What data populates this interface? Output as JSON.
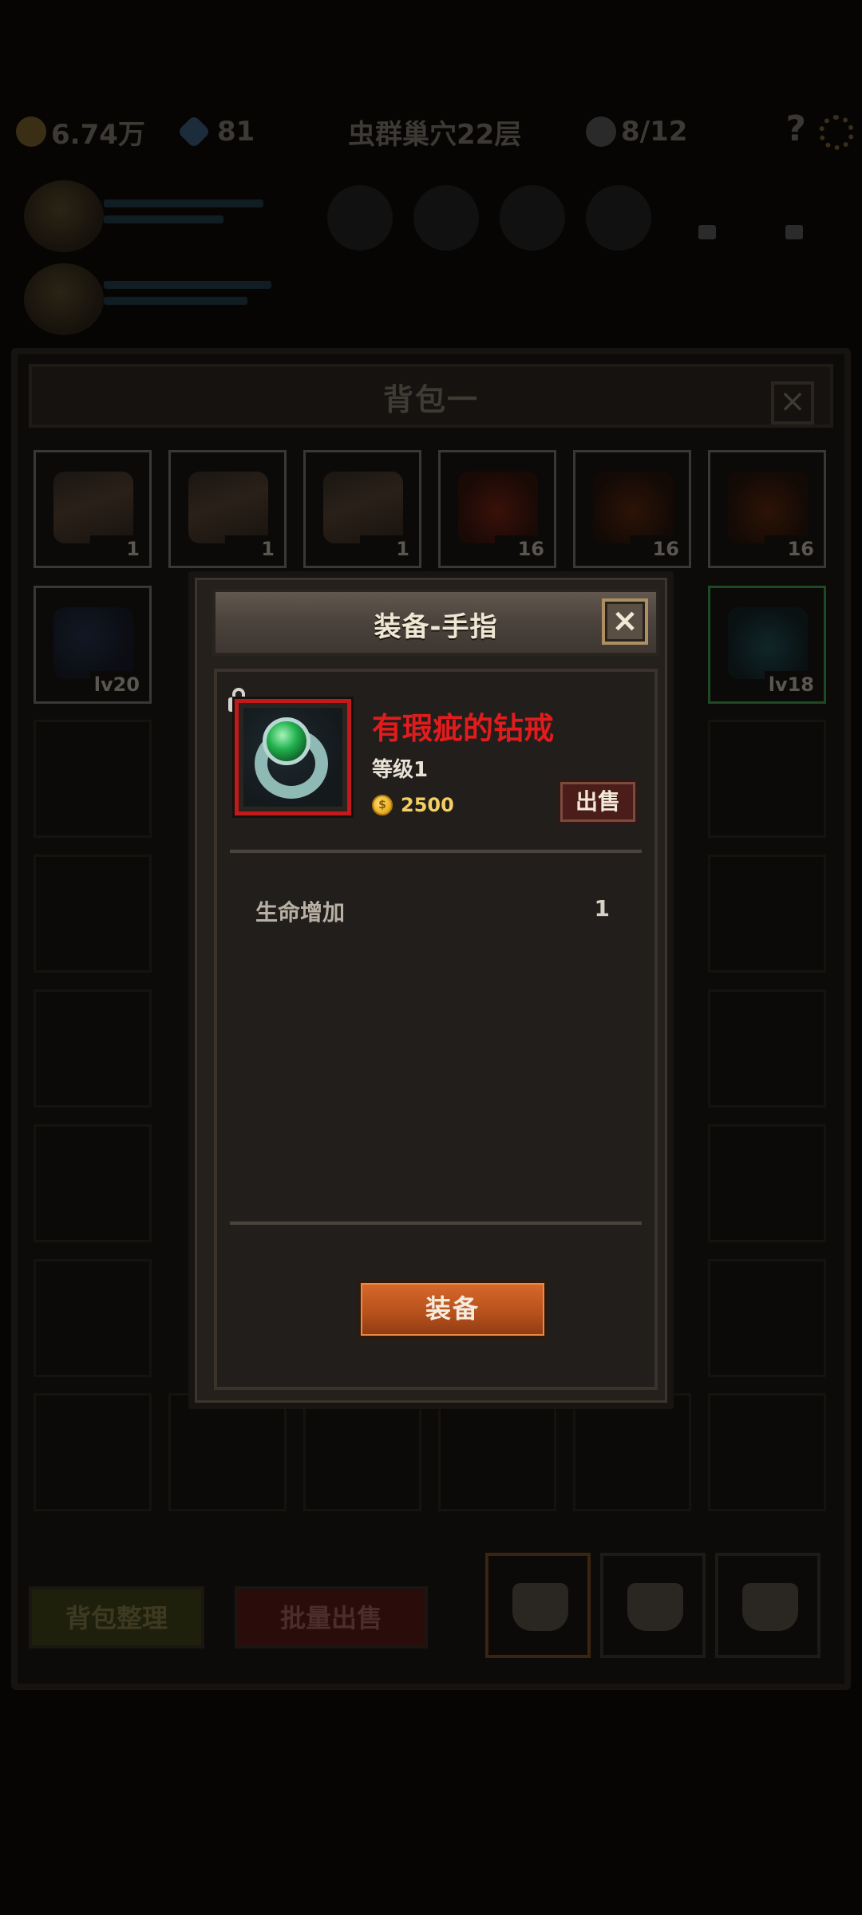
{
  "topbar": {
    "gold": "6.74万",
    "gems": "81",
    "location": "虫群巢穴22层",
    "skulls": "8/12",
    "help": "?"
  },
  "bag": {
    "title": "背包一",
    "close": "×",
    "items_row1": [
      {
        "icon": "cake-icon",
        "count": "1"
      },
      {
        "icon": "cake-icon",
        "count": "1"
      },
      {
        "icon": "cake-icon",
        "count": "1"
      },
      {
        "icon": "potion-icon",
        "count": "16"
      },
      {
        "icon": "claw-icon",
        "count": "16"
      },
      {
        "icon": "claw-icon",
        "count": "16"
      }
    ],
    "items_row2": [
      {
        "icon": "axe-icon",
        "count": "lv20"
      },
      {
        "icon": "amulet-icon",
        "count": "lv18"
      }
    ],
    "sort_label": "背包整理",
    "bulk_sell_label": "批量出售"
  },
  "modal": {
    "title": "装备-手指",
    "close": "×",
    "item": {
      "name": "有瑕疵的钻戒",
      "level": "等级1",
      "price": "2500",
      "icon": "ring-icon",
      "name_color": "#e01c1c"
    },
    "sell_label": "出售",
    "stats": [
      {
        "name": "生命增加",
        "value": "1"
      }
    ],
    "equip_label": "装备"
  }
}
